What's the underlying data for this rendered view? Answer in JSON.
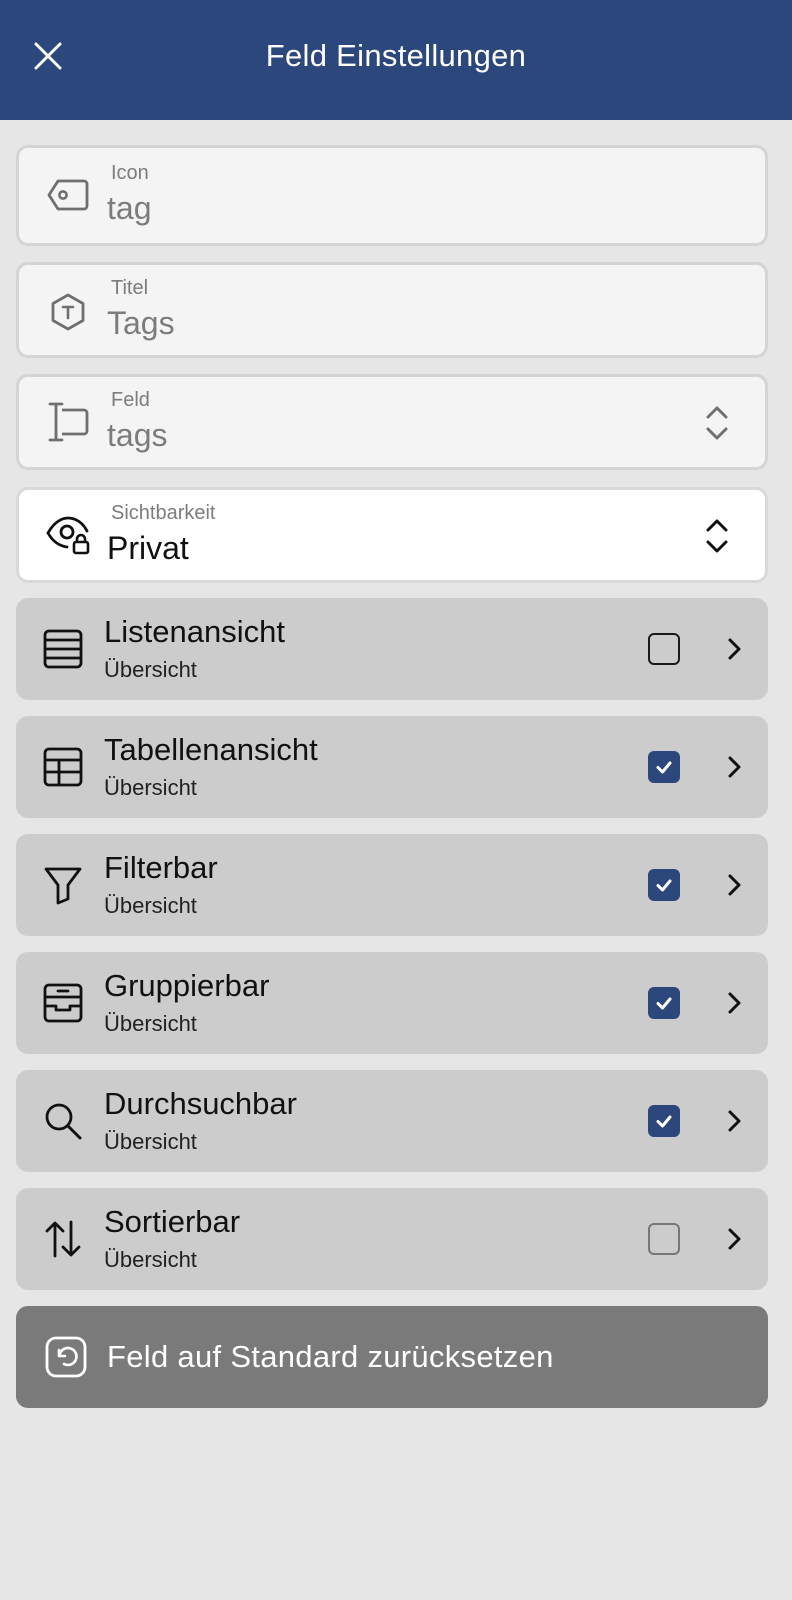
{
  "header": {
    "title": "Feld Einstellungen",
    "close_icon": "close-icon"
  },
  "fields": {
    "icon": {
      "label": "Icon",
      "value": "tag",
      "icon": "tag-icon"
    },
    "title": {
      "label": "Titel",
      "value": "Tags",
      "icon": "title-hexagon-icon"
    },
    "field": {
      "label": "Feld",
      "value": "tags",
      "icon": "input-field-icon"
    },
    "visibility": {
      "label": "Sichtbarkeit",
      "value": "Privat",
      "icon": "eye-lock-icon"
    }
  },
  "options": [
    {
      "title": "Listenansicht",
      "subtitle": "Übersicht",
      "checked": false,
      "icon": "list-icon"
    },
    {
      "title": "Tabellenansicht",
      "subtitle": "Übersicht",
      "checked": true,
      "icon": "table-icon"
    },
    {
      "title": "Filterbar",
      "subtitle": "Übersicht",
      "checked": true,
      "icon": "filter-icon"
    },
    {
      "title": "Gruppierbar",
      "subtitle": "Übersicht",
      "checked": true,
      "icon": "archive-box-icon"
    },
    {
      "title": "Durchsuchbar",
      "subtitle": "Übersicht",
      "checked": true,
      "icon": "search-icon"
    },
    {
      "title": "Sortierbar",
      "subtitle": "Übersicht",
      "checked": false,
      "icon": "sort-arrows-icon"
    }
  ],
  "reset": {
    "label": "Feld auf Standard zurücksetzen",
    "icon": "reset-icon"
  },
  "colors": {
    "primary": "#2c477b",
    "background": "#e6e6e6",
    "row": "#cccccc",
    "reset": "#7a7a7a"
  }
}
